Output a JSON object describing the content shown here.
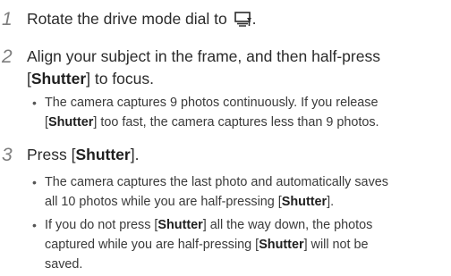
{
  "steps": [
    {
      "number": "1",
      "text_before_icon": "Rotate the drive mode dial to ",
      "icon": "continuous-shooting-icon",
      "text_after_icon": "."
    },
    {
      "number": "2",
      "line1": "Align your subject in the frame, and then half-press",
      "line2_pre": "[",
      "line2_bold": "Shutter",
      "line2_post": "] to focus.",
      "bullet": {
        "l1": "The camera captures 9 photos continuously. If you release",
        "l2_pre": "[",
        "l2_bold": "Shutter",
        "l2_post": "] too fast, the camera captures less than 9 photos."
      }
    },
    {
      "number": "3",
      "pre": "Press [",
      "bold": "Shutter",
      "post": "].",
      "bullets": [
        {
          "l1": "The camera captures the last photo and automatically saves",
          "l2_pre": "all 10 photos while you are half-pressing [",
          "l2_bold": "Shutter",
          "l2_post": "]."
        },
        {
          "l1_pre": "If you do not press [",
          "l1_bold": "Shutter",
          "l1_post": "] all the way down, the photos",
          "l2_pre": "captured while you are half-pressing [",
          "l2_bold": "Shutter",
          "l2_post": "] will not be",
          "l3": "saved."
        }
      ]
    }
  ],
  "bullet_glyph": "•"
}
